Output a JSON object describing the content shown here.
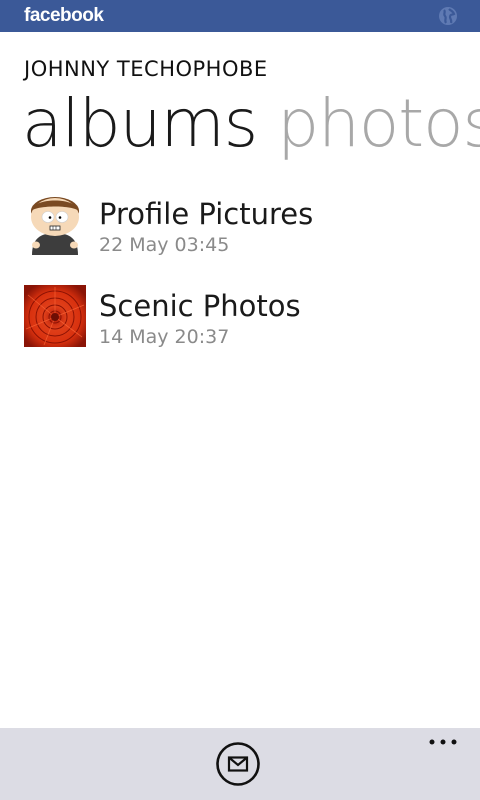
{
  "app": {
    "brand": "facebook",
    "brand_color": "#3b5998",
    "globe_icon": "globe-icon"
  },
  "header": {
    "username": "JOHNNY TECHOPHOBE",
    "pivots": [
      {
        "label": "albums",
        "active": true
      },
      {
        "label": "photos",
        "active": false
      }
    ]
  },
  "albums": [
    {
      "title": "Profile Pictures",
      "date": "22 May 03:45",
      "thumbnail": "cartoon-avatar"
    },
    {
      "title": "Scenic Photos",
      "date": "14 May 20:37",
      "thumbnail": "red-flower"
    }
  ],
  "appbar": {
    "background": "#dcdce4",
    "buttons": [
      {
        "icon": "message-icon"
      },
      {
        "icon": "more-icon"
      }
    ]
  }
}
